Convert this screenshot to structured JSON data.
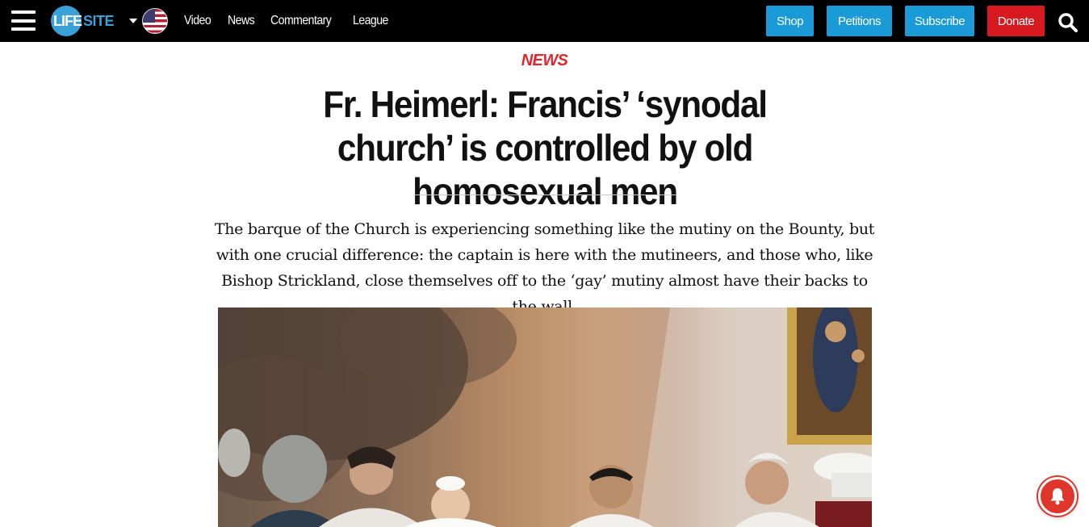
{
  "nav": {
    "logo_left": "LIFE",
    "logo_right": "SITE",
    "links": [
      "Video",
      "News",
      "Commentary",
      "League"
    ],
    "buttons": {
      "shop": "Shop",
      "petitions": "Petitions",
      "subscribe": "Subscribe",
      "donate": "Donate"
    }
  },
  "article": {
    "category": "NEWS",
    "headline": "Fr. Heimerl: Francis’ ‘synodal church’ is controlled by old homosexual men",
    "subheadline": "The barque of the Church is experiencing something like the mutiny on the Bounty, but with one crucial difference: the captain is here with the mutineers, and those who, like Bishop Strickland, close themselves off to the ‘gay’ mutiny almost have their backs to the wall."
  },
  "colors": {
    "topbar": "#000000",
    "accent_blue": "#1a9ad6",
    "donate_red": "#d8191f",
    "category_red": "#e1262d",
    "bell_red": "#e0352b"
  },
  "icons": [
    "menu-icon",
    "flag-icon",
    "search-icon",
    "bell-icon"
  ]
}
